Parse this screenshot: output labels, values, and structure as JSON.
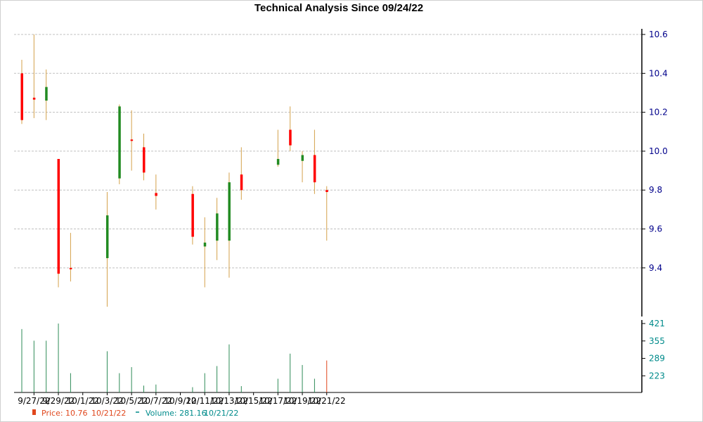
{
  "chart_data": {
    "type": "candlestick",
    "title": "Technical Analysis Since 09/24/22",
    "colors": {
      "up": "#228b22",
      "down": "#ff0000",
      "wick": "#d4a14a",
      "volume": "#2e8b57",
      "volume_last": "#e0471d",
      "grid": "#c0c0c0",
      "price_axis": "#00008b",
      "volume_axis": "#008b8b"
    },
    "price_axis": {
      "ylim": [
        9.15,
        10.6
      ],
      "ticks": [
        "9.4",
        "9.6",
        "9.8",
        "10.0",
        "10.2",
        "10.4",
        "10.6"
      ]
    },
    "volume_axis": {
      "ylim": [
        160,
        421
      ],
      "ticks": [
        "223",
        "289",
        "355",
        "421"
      ]
    },
    "x_axis": {
      "tick_labels": [
        "9/27/22",
        "9/29/22",
        "10/1/22",
        "10/3/22",
        "10/5/22",
        "10/7/22",
        "10/9/22",
        "10/11/22",
        "10/13/22",
        "10/15/22",
        "10/17/22",
        "10/19/22",
        "10/21/22"
      ],
      "first_day": "9/26/22",
      "days": 26
    },
    "candles": [
      {
        "date": "9/26/22",
        "open": 10.16,
        "high": 10.47,
        "low": 10.14,
        "close": 10.4,
        "direction": "down",
        "volume": 400
      },
      {
        "date": "9/27/22",
        "open": 10.275,
        "high": 10.6,
        "low": 10.17,
        "close": 10.265,
        "direction": "down",
        "volume": 356
      },
      {
        "date": "9/28/22",
        "open": 10.26,
        "high": 10.42,
        "low": 10.16,
        "close": 10.33,
        "direction": "up",
        "volume": 356
      },
      {
        "date": "9/29/22",
        "open": 9.37,
        "high": 9.96,
        "low": 9.3,
        "close": 9.96,
        "direction": "down",
        "volume": 421
      },
      {
        "date": "9/30/22",
        "open": 9.4,
        "high": 9.58,
        "low": 9.33,
        "close": 9.4,
        "direction": "down",
        "volume": 233
      },
      {
        "date": "10/3/22",
        "open": 9.45,
        "high": 9.79,
        "low": 9.2,
        "close": 9.67,
        "direction": "up",
        "volume": 316
      },
      {
        "date": "10/4/22",
        "open": 9.86,
        "high": 10.24,
        "low": 9.83,
        "close": 10.23,
        "direction": "up",
        "volume": 233
      },
      {
        "date": "10/5/22",
        "open": 10.06,
        "high": 10.21,
        "low": 9.9,
        "close": 10.06,
        "direction": "down",
        "volume": 256
      },
      {
        "date": "10/6/22",
        "open": 10.02,
        "high": 10.09,
        "low": 9.85,
        "close": 9.89,
        "direction": "down",
        "volume": 186
      },
      {
        "date": "10/7/22",
        "open": 9.785,
        "high": 9.88,
        "low": 9.7,
        "close": 9.77,
        "direction": "down",
        "volume": 190
      },
      {
        "date": "10/10/22",
        "open": 9.78,
        "high": 9.82,
        "low": 9.52,
        "close": 9.56,
        "direction": "down",
        "volume": 180
      },
      {
        "date": "10/11/22",
        "open": 9.51,
        "high": 9.66,
        "low": 9.3,
        "close": 9.53,
        "direction": "up",
        "volume": 233
      },
      {
        "date": "10/12/22",
        "open": 9.54,
        "high": 9.76,
        "low": 9.44,
        "close": 9.68,
        "direction": "up",
        "volume": 260
      },
      {
        "date": "10/13/22",
        "open": 9.54,
        "high": 9.89,
        "low": 9.35,
        "close": 9.84,
        "direction": "up",
        "volume": 342
      },
      {
        "date": "10/14/22",
        "open": 9.88,
        "high": 10.02,
        "low": 9.75,
        "close": 9.8,
        "direction": "down",
        "volume": 184
      },
      {
        "date": "10/17/22",
        "open": 9.93,
        "high": 10.11,
        "low": 9.92,
        "close": 9.96,
        "direction": "up",
        "volume": 212
      },
      {
        "date": "10/18/22",
        "open": 10.11,
        "high": 10.23,
        "low": 10.0,
        "close": 10.03,
        "direction": "down",
        "volume": 307
      },
      {
        "date": "10/19/22",
        "open": 9.95,
        "high": 10.0,
        "low": 9.84,
        "close": 9.98,
        "direction": "up",
        "volume": 264
      },
      {
        "date": "10/20/22",
        "open": 9.98,
        "high": 10.11,
        "low": 9.78,
        "close": 9.84,
        "direction": "down",
        "volume": 212
      },
      {
        "date": "10/21/22",
        "open": 9.8,
        "high": 9.82,
        "low": 9.54,
        "close": 9.79,
        "direction": "down",
        "volume": 281
      }
    ],
    "legend": {
      "price": {
        "label": "Price: 10.76",
        "date": "10/21/22"
      },
      "volume": {
        "label": "Volume: 281.16",
        "date": "10/21/22"
      }
    }
  }
}
